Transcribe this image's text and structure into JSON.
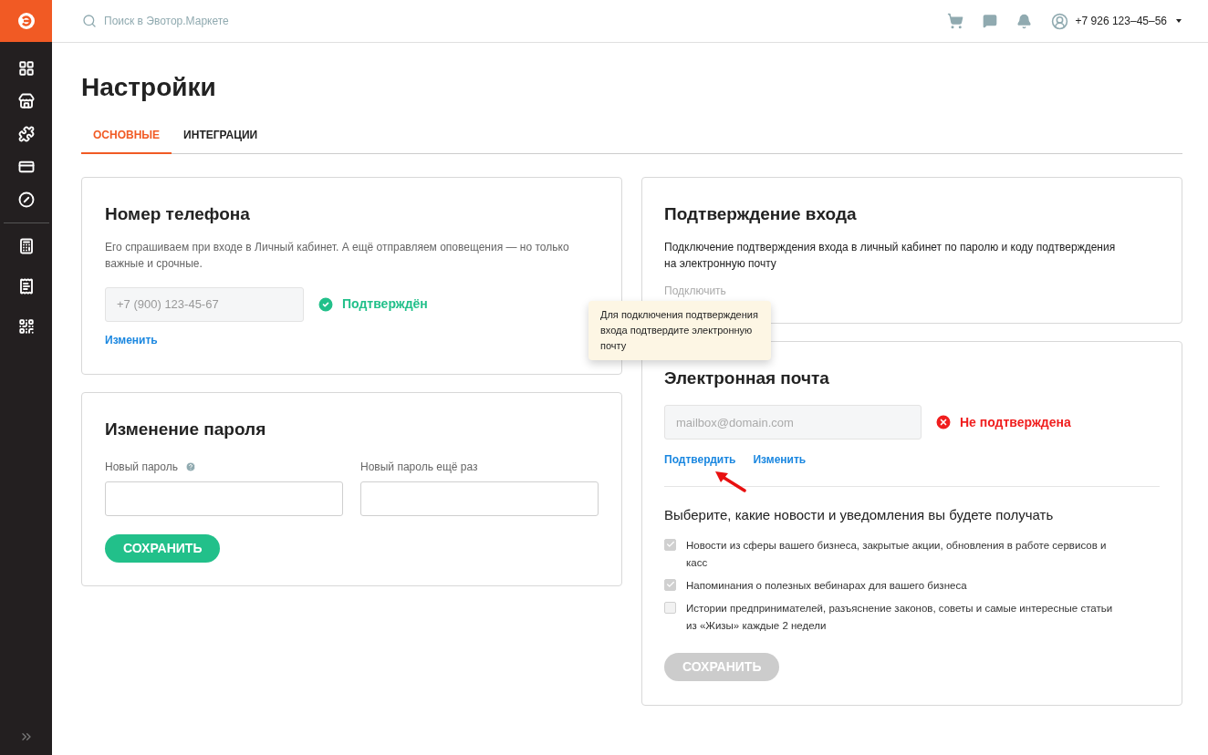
{
  "header": {
    "search": {
      "placeholder": "Поиск в Эвотор.Маркете"
    },
    "user": {
      "phone": "+7 926 123–45–56"
    }
  },
  "page": {
    "title": "Настройки"
  },
  "tabs": [
    {
      "label": "ОСНОВНЫЕ",
      "selected": true
    },
    {
      "label": "ИНТЕГРАЦИИ",
      "selected": false
    }
  ],
  "phone_card": {
    "title": "Номер телефона",
    "description": "Его спрашиваем при входе в Личный кабинет. А ещё отправляем оповещения — но только важные и срочные.",
    "field": {
      "value": "+7 (900) 123-45-67"
    },
    "status": {
      "text": "Подтверждён",
      "confirmed": true
    },
    "link": "Изменить"
  },
  "password_card": {
    "title": "Изменение пароля",
    "fields": [
      {
        "label": "Новый пароль",
        "help": true
      },
      {
        "label": "Новый пароль ещё раз",
        "help": false
      }
    ],
    "button": {
      "label": "СОХРАНИТЬ",
      "disabled": false
    }
  },
  "login_confirm_card": {
    "title": "Подтверждение входа",
    "description": "Подключение подтверждения входа в личный кабинет по паролю и коду подтверждения на электронную почту",
    "link": {
      "label": "Подключить",
      "disabled": true
    }
  },
  "tooltip": {
    "text": "Для подключения подтверждения входа подтвердите электронную почту"
  },
  "email_card": {
    "title": "Электронная почта",
    "field": {
      "placeholder": "mailbox@domain.com"
    },
    "status": {
      "text": "Не подтверждена",
      "confirmed": false
    },
    "links": [
      "Подтвердить",
      "Изменить"
    ],
    "subscriptions_title": "Выберите, какие новости и уведомления вы будете получать",
    "subscriptions": [
      {
        "label": "Новости из сферы вашего бизнеса, закрытые акции, обновления в работе сервисов и касс",
        "checked": true,
        "disabled": true
      },
      {
        "label": "Напоминания о полезных вебинарах для вашего бизнеса",
        "checked": true,
        "disabled": true
      },
      {
        "label": "Истории предпринимателей, разъяснение законов, советы и самые интересные статьи из «Жизы» каждые 2 недели",
        "checked": false,
        "disabled": true
      }
    ],
    "button": {
      "label": "СОХРАНИТЬ",
      "disabled": true
    }
  }
}
